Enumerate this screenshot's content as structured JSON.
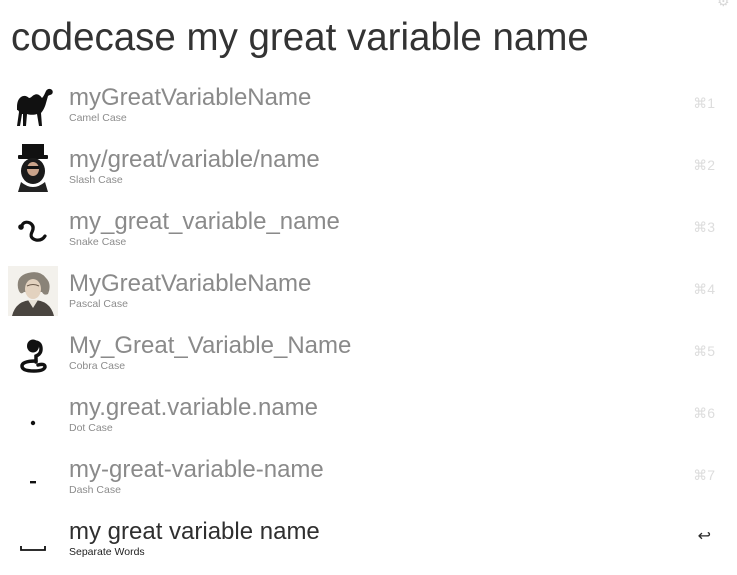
{
  "query": "codecase my great variable name",
  "results": [
    {
      "title": "myGreatVariableName",
      "subtitle": "Camel Case",
      "shortcut": "⌘1",
      "icon": "camel-icon"
    },
    {
      "title": "my/great/variable/name",
      "subtitle": "Slash Case",
      "shortcut": "⌘2",
      "icon": "slash-guitarist-icon"
    },
    {
      "title": "my_great_variable_name",
      "subtitle": "Snake Case",
      "shortcut": "⌘3",
      "icon": "snake-icon"
    },
    {
      "title": "MyGreatVariableName",
      "subtitle": "Pascal Case",
      "shortcut": "⌘4",
      "icon": "pascal-portrait-icon"
    },
    {
      "title": "My_Great_Variable_Name",
      "subtitle": "Cobra Case",
      "shortcut": "⌘5",
      "icon": "cobra-icon"
    },
    {
      "title": "my.great.variable.name",
      "subtitle": "Dot Case",
      "shortcut": "⌘6",
      "icon": "dot-icon"
    },
    {
      "title": "my-great-variable-name",
      "subtitle": "Dash Case",
      "shortcut": "⌘7",
      "icon": "dash-icon"
    },
    {
      "title": "my great variable name",
      "subtitle": "Separate Words",
      "shortcut": "↩",
      "icon": "space-icon",
      "selected": true
    }
  ]
}
